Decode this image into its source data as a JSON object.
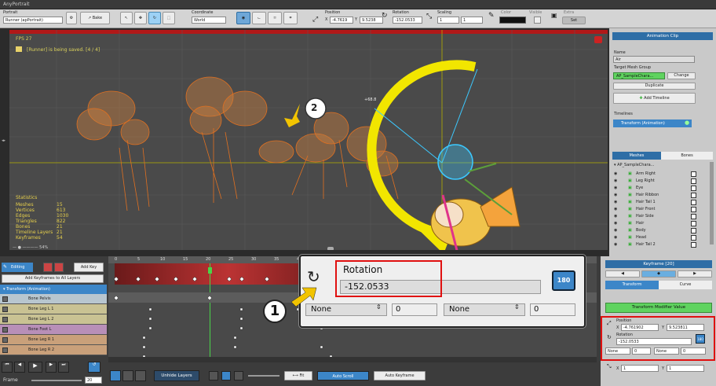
{
  "window": {
    "title": "AnyPortrait"
  },
  "toolbar": {
    "portrait_label": "Portrait",
    "portrait_value": "Runner (apPortrait)",
    "bake_label": "Bake",
    "coordinate_label": "Coordinate",
    "coordinate_value": "World",
    "position_label": "Position",
    "pos_x_label": "X",
    "pos_x": "-4.7619",
    "pos_y_label": "Y",
    "pos_y": "9.5238",
    "rotation_label": "Rotation",
    "rotation_value": "-152.0533",
    "scaling_label": "Scaling",
    "scale_x": "1",
    "scale_y": "1",
    "color_label": "Color",
    "visible_label": "Visible",
    "extra_label": "Extra",
    "set_label": "Set"
  },
  "viewport": {
    "fps": "FPS 27",
    "saved_msg": "[Runner] is being saved. [4 / 4]",
    "angle_label": "+68.8",
    "callout_2": "2",
    "callout_1": "1",
    "zoom_pct": "54%",
    "stats_title": "Statistics",
    "stats": [
      {
        "k": "Meshes",
        "v": "15"
      },
      {
        "k": "Vertices",
        "v": "613"
      },
      {
        "k": "Edges",
        "v": "1030"
      },
      {
        "k": "Triangles",
        "v": "822"
      },
      {
        "k": "Bones",
        "v": "21"
      },
      {
        "k": "Timeline Layers",
        "v": "21"
      },
      {
        "k": "Keyframes",
        "v": "54"
      }
    ]
  },
  "right_panel": {
    "header": "Animation Clip",
    "name_label": "Name",
    "name_value": "Air",
    "target_label": "Target Mesh Group",
    "target_value": "AP_SampleChara...",
    "change_label": "Change",
    "duplicate_label": "Duplicate",
    "add_timeline_label": "Add Timeline",
    "timelines_label": "Timelines",
    "timeline_item": "Transform (Animation)",
    "tab_meshes": "Meshes",
    "tab_bones": "Bones",
    "root_item": "AP_SampleChara...",
    "mesh_items": [
      "Arm Right",
      "Leg Right",
      "Eye",
      "Hair Ribbon",
      "Hair Tail 1",
      "Hair Front",
      "Hair Side",
      "Hair",
      "Body",
      "Head",
      "Hair Tail 2"
    ]
  },
  "timeline": {
    "editing_label": "Editing",
    "add_key_label": "Add Key",
    "add_all_label": "Add Keyframes to All Layers",
    "layer_header": "Transform (Animation)",
    "layers": [
      "Bone Pelvis",
      "Bone Leg L 1",
      "Bone Leg L 2",
      "Bone Foot L",
      "Bone Leg R 1",
      "Bone Leg R 2"
    ],
    "ruler": [
      "0",
      "5",
      "10",
      "15",
      "20",
      "25",
      "30",
      "35",
      "40",
      "45",
      "50",
      "55",
      "60"
    ],
    "frame_label": "Frame",
    "frame_value": "20",
    "unhide_label": "Unhide Layers",
    "fit_label": "Fit",
    "auto_scroll_label": "Auto Scroll",
    "auto_keyframe_label": "Auto Keyframe"
  },
  "zoom_box": {
    "title": "Rotation",
    "value": "-152.0533",
    "none_a": "None",
    "val_a": "0",
    "none_b": "None",
    "val_b": "0",
    "btn_180": "180"
  },
  "keyframe_panel": {
    "header": "Keyframe [20]",
    "tab_transform": "Transform",
    "tab_curve": "Curve",
    "modifier_label": "Transform Modifier Value",
    "position_label": "Position",
    "pos_x_label": "X",
    "pos_x": "-4.761902",
    "pos_y_label": "Y",
    "pos_y": "9.523811",
    "rotation_label": "Rotation",
    "rotation_value": "-152.0533",
    "none_a": "None",
    "val_a": "0",
    "none_b": "None",
    "val_b": "0",
    "scale_x_label": "X",
    "scale_x": "1",
    "scale_y_label": "Y",
    "scale_y": "1"
  }
}
